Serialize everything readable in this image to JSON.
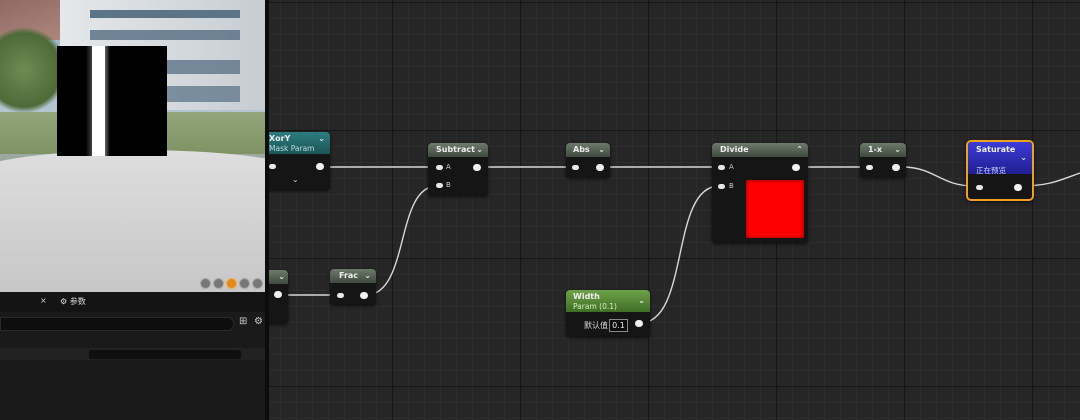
{
  "graph": {
    "nodes": {
      "xory": {
        "title": "XorY",
        "subtitle": "Mask Param"
      },
      "subtract": {
        "title": "Subtract",
        "pin_a": "A",
        "pin_b": "B"
      },
      "abs": {
        "title": "Abs"
      },
      "divide": {
        "title": "Divide",
        "pin_a": "A",
        "pin_b": "B",
        "preview_color": "#ff0000"
      },
      "one_minus_x": {
        "title": "1-x"
      },
      "saturate": {
        "title": "Saturate",
        "subtitle": "正在预览"
      },
      "frac": {
        "title": "Frac"
      },
      "width": {
        "title": "Width",
        "subtitle": "Param (0.1)",
        "default_label": "默认值",
        "default_value": "0.1"
      }
    }
  },
  "panel": {
    "tab_params": "参数"
  },
  "colors": {
    "math_header": "#5a6758",
    "param_header": "#4f8a2e",
    "mask_header": "#236a6c",
    "saturate_header": "#2c2cb8",
    "selection_outline": "#f0a020"
  }
}
